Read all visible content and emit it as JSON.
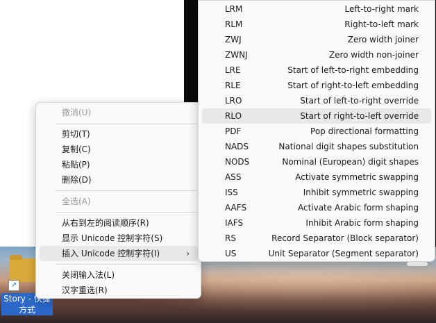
{
  "desktop": {
    "icon_label_selected": "Story - 快捷",
    "icon_label_line2": "方式"
  },
  "context_menu": {
    "items": [
      {
        "label": "撤消(U)",
        "disabled": true
      },
      {
        "label": "剪切(T)",
        "disabled": false
      },
      {
        "label": "复制(C)",
        "disabled": false
      },
      {
        "label": "粘贴(P)",
        "disabled": false
      },
      {
        "label": "删除(D)",
        "disabled": false
      },
      {
        "label": "全选(A)",
        "disabled": true
      },
      {
        "label": "从右到左的阅读顺序(R)",
        "disabled": false
      },
      {
        "label": "显示 Unicode 控制字符(S)",
        "disabled": false
      },
      {
        "label": "插入 Unicode 控制字符(I)",
        "disabled": false,
        "submenu": true,
        "active": true
      },
      {
        "label": "关闭输入法(L)",
        "disabled": false
      },
      {
        "label": "汉字重选(R)",
        "disabled": false
      }
    ],
    "submenu_chevron": "›"
  },
  "unicode_submenu": {
    "items": [
      {
        "code": "LRM",
        "desc": "Left-to-right mark"
      },
      {
        "code": "RLM",
        "desc": "Right-to-left mark"
      },
      {
        "code": "ZWJ",
        "desc": "Zero width joiner"
      },
      {
        "code": "ZWNJ",
        "desc": "Zero width non-joiner"
      },
      {
        "code": "LRE",
        "desc": "Start of left-to-right embedding"
      },
      {
        "code": "RLE",
        "desc": "Start of right-to-left embedding"
      },
      {
        "code": "LRO",
        "desc": "Start of left-to-right override"
      },
      {
        "code": "RLO",
        "desc": "Start of right-to-left override",
        "active": true
      },
      {
        "code": "PDF",
        "desc": "Pop directional formatting"
      },
      {
        "code": "NADS",
        "desc": "National digit shapes substitution"
      },
      {
        "code": "NODS",
        "desc": "Nominal (European) digit shapes"
      },
      {
        "code": "ASS",
        "desc": "Activate symmetric swapping"
      },
      {
        "code": "ISS",
        "desc": "Inhibit symmetric swapping"
      },
      {
        "code": "AAFS",
        "desc": "Activate Arabic form shaping"
      },
      {
        "code": "IAFS",
        "desc": "Inhibit Arabic form shaping"
      },
      {
        "code": "RS",
        "desc": "Record Separator (Block separator)"
      },
      {
        "code": "US",
        "desc": "Unit Separator (Segment separator)"
      }
    ]
  }
}
